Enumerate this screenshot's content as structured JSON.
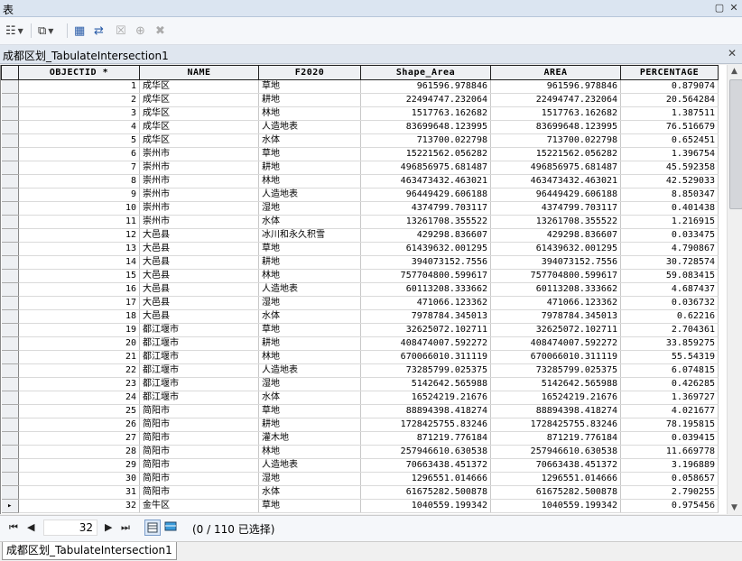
{
  "window": {
    "title": "表"
  },
  "table_tab": {
    "label": "成都区划_TabulateIntersection1"
  },
  "columns": [
    "OBJECTID *",
    "NAME",
    "F2020",
    "Shape_Area",
    "AREA",
    "PERCENTAGE"
  ],
  "rows": [
    [
      "1",
      "成华区",
      "草地",
      "961596.978846",
      "961596.978846",
      "0.879074"
    ],
    [
      "2",
      "成华区",
      "耕地",
      "22494747.232064",
      "22494747.232064",
      "20.564284"
    ],
    [
      "3",
      "成华区",
      "林地",
      "1517763.162682",
      "1517763.162682",
      "1.387511"
    ],
    [
      "4",
      "成华区",
      "人造地表",
      "83699648.123995",
      "83699648.123995",
      "76.516679"
    ],
    [
      "5",
      "成华区",
      "水体",
      "713700.022798",
      "713700.022798",
      "0.652451"
    ],
    [
      "6",
      "崇州市",
      "草地",
      "15221562.056282",
      "15221562.056282",
      "1.396754"
    ],
    [
      "7",
      "崇州市",
      "耕地",
      "496856975.681487",
      "496856975.681487",
      "45.592358"
    ],
    [
      "8",
      "崇州市",
      "林地",
      "463473432.463021",
      "463473432.463021",
      "42.529033"
    ],
    [
      "9",
      "崇州市",
      "人造地表",
      "96449429.606188",
      "96449429.606188",
      "8.850347"
    ],
    [
      "10",
      "崇州市",
      "湿地",
      "4374799.703117",
      "4374799.703117",
      "0.401438"
    ],
    [
      "11",
      "崇州市",
      "水体",
      "13261708.355522",
      "13261708.355522",
      "1.216915"
    ],
    [
      "12",
      "大邑县",
      "冰川和永久积雪",
      "429298.836607",
      "429298.836607",
      "0.033475"
    ],
    [
      "13",
      "大邑县",
      "草地",
      "61439632.001295",
      "61439632.001295",
      "4.790867"
    ],
    [
      "14",
      "大邑县",
      "耕地",
      "394073152.7556",
      "394073152.7556",
      "30.728574"
    ],
    [
      "15",
      "大邑县",
      "林地",
      "757704800.599617",
      "757704800.599617",
      "59.083415"
    ],
    [
      "16",
      "大邑县",
      "人造地表",
      "60113208.333662",
      "60113208.333662",
      "4.687437"
    ],
    [
      "17",
      "大邑县",
      "湿地",
      "471066.123362",
      "471066.123362",
      "0.036732"
    ],
    [
      "18",
      "大邑县",
      "水体",
      "7978784.345013",
      "7978784.345013",
      "0.62216"
    ],
    [
      "19",
      "都江堰市",
      "草地",
      "32625072.102711",
      "32625072.102711",
      "2.704361"
    ],
    [
      "20",
      "都江堰市",
      "耕地",
      "408474007.592272",
      "408474007.592272",
      "33.859275"
    ],
    [
      "21",
      "都江堰市",
      "林地",
      "670066010.311119",
      "670066010.311119",
      "55.54319"
    ],
    [
      "22",
      "都江堰市",
      "人造地表",
      "73285799.025375",
      "73285799.025375",
      "6.074815"
    ],
    [
      "23",
      "都江堰市",
      "湿地",
      "5142642.565988",
      "5142642.565988",
      "0.426285"
    ],
    [
      "24",
      "都江堰市",
      "水体",
      "16524219.21676",
      "16524219.21676",
      "1.369727"
    ],
    [
      "25",
      "简阳市",
      "草地",
      "88894398.418274",
      "88894398.418274",
      "4.021677"
    ],
    [
      "26",
      "简阳市",
      "耕地",
      "1728425755.83246",
      "1728425755.83246",
      "78.195815"
    ],
    [
      "27",
      "简阳市",
      "灌木地",
      "871219.776184",
      "871219.776184",
      "0.039415"
    ],
    [
      "28",
      "简阳市",
      "林地",
      "257946610.630538",
      "257946610.630538",
      "11.669778"
    ],
    [
      "29",
      "简阳市",
      "人造地表",
      "70663438.451372",
      "70663438.451372",
      "3.196889"
    ],
    [
      "30",
      "简阳市",
      "湿地",
      "1296551.014666",
      "1296551.014666",
      "0.058657"
    ],
    [
      "31",
      "简阳市",
      "水体",
      "61675282.500878",
      "61675282.500878",
      "2.790255"
    ],
    [
      "32",
      "金牛区",
      "草地",
      "1040559.199342",
      "1040559.199342",
      "0.975456"
    ]
  ],
  "status": {
    "current_record": "32",
    "selection_text": "(0 / 110 已选择)"
  },
  "bottom_tab": {
    "label": "成都区划_TabulateIntersection1"
  }
}
